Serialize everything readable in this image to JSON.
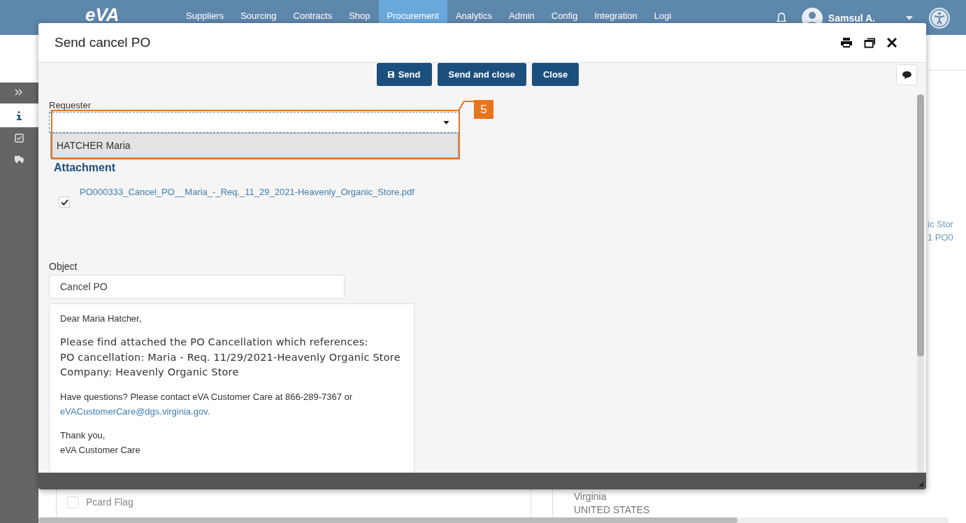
{
  "top_nav": {
    "logo": "eVA",
    "items": [
      {
        "label": "Suppliers",
        "selected": false
      },
      {
        "label": "Sourcing",
        "selected": false
      },
      {
        "label": "Contracts",
        "selected": false
      },
      {
        "label": "Shop",
        "selected": false
      },
      {
        "label": "Procurement",
        "selected": true
      },
      {
        "label": "Analytics",
        "selected": false
      },
      {
        "label": "Admin",
        "selected": false
      },
      {
        "label": "Config",
        "selected": false
      },
      {
        "label": "Integration",
        "selected": false
      },
      {
        "label": "Logi",
        "selected": false
      }
    ],
    "user": "Samsul A."
  },
  "side_rail": {
    "items": [
      {
        "kind": "expand",
        "selected": false
      },
      {
        "kind": "info",
        "selected": true
      },
      {
        "kind": "tasks",
        "selected": false
      },
      {
        "kind": "shipping",
        "selected": false
      }
    ]
  },
  "background_page": {
    "fragments": [
      "ic Stor",
      "1 PO0"
    ],
    "pcard_flag": {
      "label": "Pcard Flag",
      "checked": false
    },
    "address": [
      "Virginia",
      "UNITED STATES"
    ]
  },
  "dialog": {
    "title": "Send cancel PO",
    "buttons": [
      {
        "label": "Send",
        "kind": "save"
      },
      {
        "label": "Send and close",
        "kind": "plain"
      },
      {
        "label": "Close",
        "kind": "plain"
      }
    ],
    "requester": {
      "label": "Requester",
      "options": [
        {
          "label": "HATCHER Maria",
          "selected": false
        }
      ]
    },
    "callout": "5",
    "attachment": {
      "heading": "Attachment",
      "files": [
        {
          "name": "PO000333_Cancel_PO__Maria_-_Req._11_29_2021-Heavenly_Organic_Store.pdf",
          "checked": true
        }
      ]
    },
    "object": {
      "label": "Object",
      "value": "Cancel PO"
    },
    "message": [
      {
        "kind": "plain",
        "lines": [
          "Dear Maria Hatcher,"
        ]
      },
      {
        "kind": "wide",
        "lines": [
          "Please find attached the PO Cancellation which references:",
          "PO cancellation: Maria - Req. 11/29/2021-Heavenly Organic Store",
          "Company: Heavenly Organic Store"
        ]
      },
      {
        "kind": "small",
        "text": "Have questions? Please contact eVA Customer Care at 866-289-7367 or",
        "link": "eVACustomerCare@dgs.virginia.gov."
      },
      {
        "kind": "small",
        "lines": [
          "Thank you,",
          "eVA Customer Care"
        ]
      }
    ]
  }
}
